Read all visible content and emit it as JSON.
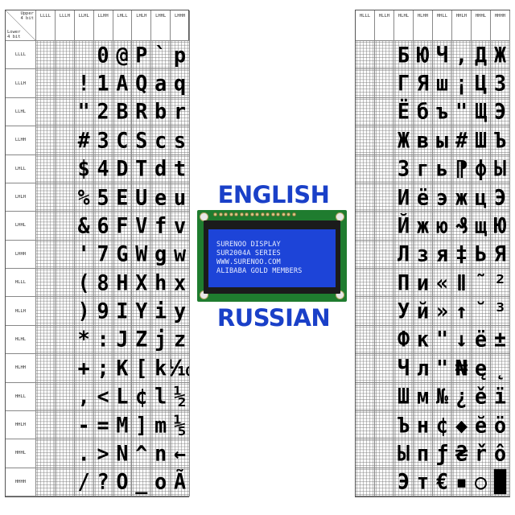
{
  "corner": {
    "upper": "Upper\n4 bit",
    "lower": "Lower\n4 bit"
  },
  "left_columns": [
    "LLLL",
    "LLLH",
    "LLHL",
    "LLHH",
    "LHLL",
    "LHLH",
    "LHHL",
    "LHHH"
  ],
  "right_columns": [
    "HLLL",
    "HLLH",
    "HLHL",
    "HLHH",
    "HHLL",
    "HHLH",
    "HHHL",
    "HHHH"
  ],
  "rows": [
    "LLLL",
    "LLLH",
    "LLHL",
    "LLHH",
    "LHLL",
    "LHLH",
    "LHHL",
    "LHHH",
    "HLLL",
    "HLLH",
    "HLHL",
    "HLHH",
    "HHLL",
    "HHLH",
    "HHHL",
    "HHHH"
  ],
  "left_glyphs": [
    [
      "",
      "",
      "",
      "0",
      "@",
      "P",
      "`",
      "p"
    ],
    [
      "",
      "",
      "!",
      "1",
      "A",
      "Q",
      "a",
      "q"
    ],
    [
      "",
      "",
      "\"",
      "2",
      "B",
      "R",
      "b",
      "r"
    ],
    [
      "",
      "",
      "#",
      "3",
      "C",
      "S",
      "c",
      "s"
    ],
    [
      "",
      "",
      "$",
      "4",
      "D",
      "T",
      "d",
      "t"
    ],
    [
      "",
      "",
      "%",
      "5",
      "E",
      "U",
      "e",
      "u"
    ],
    [
      "",
      "",
      "&",
      "6",
      "F",
      "V",
      "f",
      "v"
    ],
    [
      "",
      "",
      "'",
      "7",
      "G",
      "W",
      "g",
      "w"
    ],
    [
      "",
      "",
      "(",
      "8",
      "H",
      "X",
      "h",
      "x"
    ],
    [
      "",
      "",
      ")",
      "9",
      "I",
      "Y",
      "i",
      "y"
    ],
    [
      "",
      "",
      "*",
      ":",
      "J",
      "Z",
      "j",
      "z"
    ],
    [
      "",
      "",
      "+",
      ";",
      "K",
      "[",
      "k",
      "⅒"
    ],
    [
      "",
      "",
      ",",
      "<",
      "L",
      "¢",
      "l",
      "½"
    ],
    [
      "",
      "",
      "-",
      "=",
      "M",
      "]",
      "m",
      "⅕"
    ],
    [
      "",
      "",
      ".",
      ">",
      "N",
      "^",
      "n",
      "←"
    ],
    [
      "",
      "",
      "/",
      "?",
      "O",
      "_",
      "o",
      "Ã"
    ]
  ],
  "right_glyphs": [
    [
      "",
      "",
      "Б",
      "Ю",
      "Ч",
      ",",
      "Д",
      "Ж"
    ],
    [
      "",
      "",
      "Г",
      "Я",
      "ш",
      "¡",
      "Ц",
      "З"
    ],
    [
      "",
      "",
      "Ё",
      "б",
      "ъ",
      "\"",
      "Щ",
      "Э"
    ],
    [
      "",
      "",
      "Ж",
      "в",
      "ы",
      "#",
      "Ш",
      "Ъ"
    ],
    [
      "",
      "",
      "З",
      "г",
      "ь",
      "⁋",
      "ф",
      "Ы"
    ],
    [
      "",
      "",
      "И",
      "ё",
      "э",
      "ж",
      "ц",
      "Э"
    ],
    [
      "",
      "",
      "Й",
      "ж",
      "ю",
      "₰",
      "щ",
      "Ю"
    ],
    [
      "",
      "",
      "Л",
      "з",
      "я",
      "‡",
      "Ь",
      "Я"
    ],
    [
      "",
      "",
      "П",
      "и",
      "«",
      "Ⅱ",
      "˜",
      "²"
    ],
    [
      "",
      "",
      "У",
      "й",
      "»",
      "↑",
      "˘",
      "³"
    ],
    [
      "",
      "",
      "Ф",
      "к",
      "\"",
      "↓",
      "ё",
      "±"
    ],
    [
      "",
      "",
      "Ч",
      "л",
      "\"",
      "₦",
      "ę",
      "˛"
    ],
    [
      "",
      "",
      "Ш",
      "м",
      "№",
      "¿",
      "ě",
      "ï"
    ],
    [
      "",
      "",
      "Ъ",
      "н",
      "¢",
      "◆",
      "ĕ",
      "ö"
    ],
    [
      "",
      "",
      "Ы",
      "п",
      "ƒ",
      "₴",
      "ř",
      "ô"
    ],
    [
      "",
      "",
      "Э",
      "т",
      "€",
      "▪",
      "○",
      "█"
    ]
  ],
  "labels": {
    "english": "ENGLISH",
    "russian": "RUSSIAN"
  },
  "lcd": {
    "lines": [
      "SURENOO DISPLAY",
      "SUR2004A SERIES",
      "WWW.SURENOO.COM",
      "ALIBABA GOLD MEMBERS"
    ],
    "colors": {
      "board": "#1f7c2f",
      "screen": "#1d44d8",
      "text": "#e9eeff"
    }
  },
  "colors": {
    "label": "#1a40c8"
  }
}
